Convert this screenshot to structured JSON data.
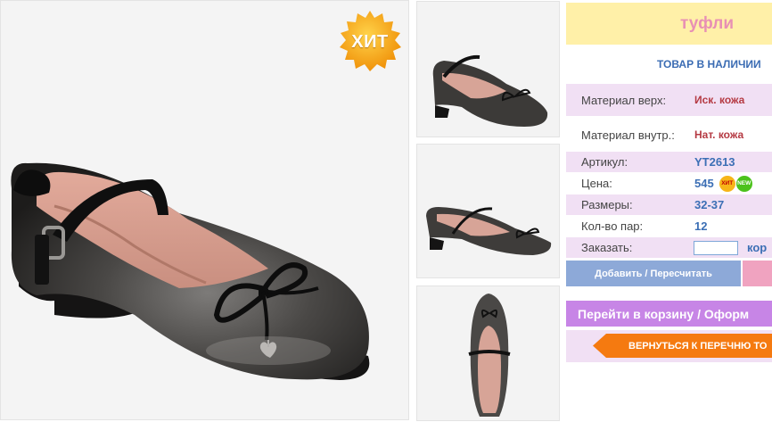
{
  "product": {
    "hit_badge": "ХИТ",
    "title": "туфли",
    "stock_status": "ТОВАР В НАЛИЧИИ",
    "specs": {
      "upper_label": "Материал верх:",
      "upper_value": "Иск. кожа",
      "inner_label": "Материал внутр.:",
      "inner_value": "Нат. кожа",
      "sku_label": "Артикул:",
      "sku_value": "YT2613",
      "price_label": "Цена:",
      "price_value": "545",
      "badge_hit": "ХИТ",
      "badge_new": "NEW",
      "sizes_label": "Размеры:",
      "sizes_value": "32-37",
      "pairs_label": "Кол-во пар:",
      "pairs_value": "12",
      "order_label": "Заказать:",
      "order_value": "",
      "order_link": "кор"
    },
    "buttons": {
      "add": "Добавить / Пересчитать",
      "cart": "Перейти в корзину / Оформ",
      "back": "ВЕРНУТЬСЯ К ПЕРЕЧНЮ ТО"
    }
  },
  "colors": {
    "title_bg": "#fff0a8",
    "title_text": "#e890b4",
    "accent_blue": "#3c6fb5",
    "accent_red": "#b53a43",
    "row_lilac": "#f1e0f4",
    "add_button": "#8da9d8",
    "cart_button": "#c785e6",
    "back_button": "#f57a10"
  }
}
